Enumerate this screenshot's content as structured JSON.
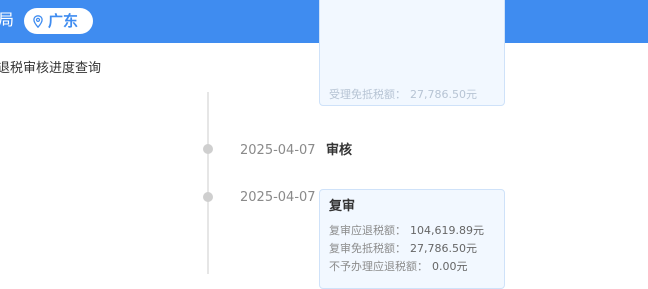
{
  "header": {
    "title": "局",
    "region_icon": "location-pin-icon",
    "region": "广东",
    "accent_color": "#3f8cf0"
  },
  "page": {
    "title": "退税审核进度查询"
  },
  "timeline": {
    "top_card": {
      "lines": [
        {
          "label": "受理免抵税额：",
          "value": "27,786.50元"
        }
      ]
    },
    "steps": [
      {
        "date": "2025-04-07",
        "title": "审核"
      },
      {
        "date": "2025-04-07",
        "title": "复审"
      }
    ],
    "review_card": {
      "title": "复审",
      "lines": [
        {
          "label": "复审应退税额：",
          "value": "104,619.89元"
        },
        {
          "label": "复审免抵税额：",
          "value": "27,786.50元"
        },
        {
          "label": "不予办理应退税额：",
          "value": "0.00元"
        }
      ]
    }
  }
}
